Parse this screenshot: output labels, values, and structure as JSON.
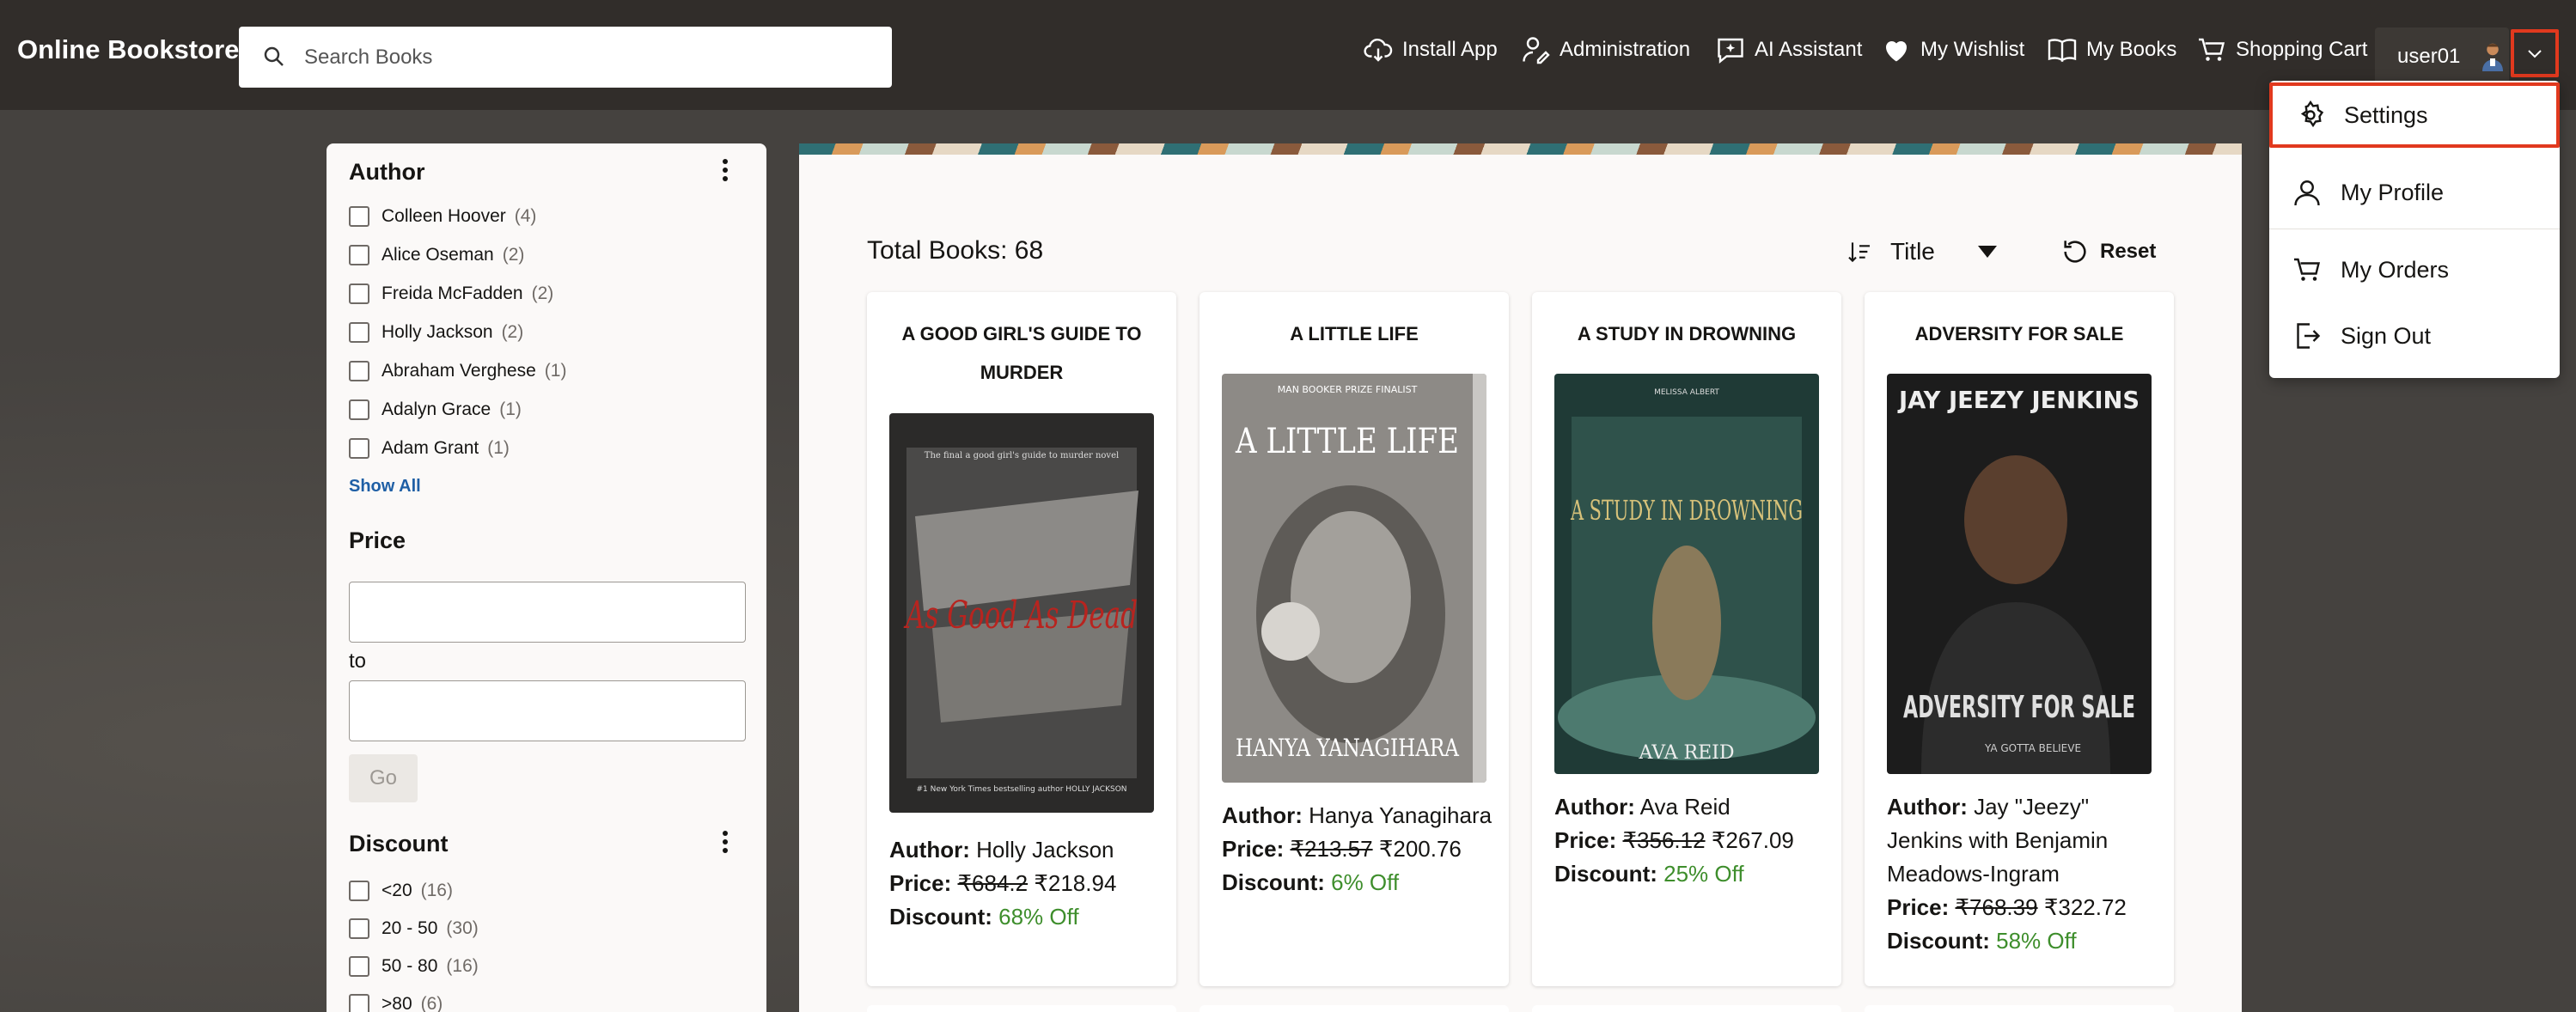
{
  "header": {
    "brand": "Online Bookstore",
    "search_placeholder": "Search Books",
    "nav": {
      "install_app": "Install App",
      "administration": "Administration",
      "ai_assistant": "AI Assistant",
      "wishlist": "My Wishlist",
      "my_books": "My Books",
      "cart": "Shopping Cart"
    },
    "username": "user01"
  },
  "user_menu": {
    "items": [
      {
        "label": "Settings",
        "icon": "gear-icon"
      },
      {
        "label": "My Profile",
        "icon": "person-icon"
      },
      {
        "label": "My Orders",
        "icon": "cart-icon"
      },
      {
        "label": "Sign Out",
        "icon": "sign-out-icon"
      }
    ]
  },
  "filters": {
    "author": {
      "title": "Author",
      "items": [
        {
          "name": "Colleen Hoover",
          "count": "(4)"
        },
        {
          "name": "Alice Oseman",
          "count": "(2)"
        },
        {
          "name": "Freida McFadden",
          "count": "(2)"
        },
        {
          "name": "Holly Jackson",
          "count": "(2)"
        },
        {
          "name": "Abraham Verghese",
          "count": "(1)"
        },
        {
          "name": "Adalyn Grace",
          "count": "(1)"
        },
        {
          "name": "Adam Grant",
          "count": "(1)"
        }
      ],
      "show_all": "Show All"
    },
    "price": {
      "title": "Price",
      "to_label": "to",
      "go_label": "Go",
      "from_value": "",
      "to_value": ""
    },
    "discount": {
      "title": "Discount",
      "items": [
        {
          "name": "<20",
          "count": "(16)"
        },
        {
          "name": "20 - 50",
          "count": "(30)"
        },
        {
          "name": "50 - 80",
          "count": "(16)"
        },
        {
          "name": ">80",
          "count": "(6)"
        }
      ]
    }
  },
  "results": {
    "total_label": "Total Books: 68",
    "sort_value": "Title",
    "reset_label": "Reset"
  },
  "labels": {
    "author": "Author:",
    "price": "Price:",
    "discount": "Discount:"
  },
  "books": [
    {
      "title": "A Good Girl's Guide to Murder",
      "author": "Holly Jackson",
      "old_price": "₹684.2",
      "price": "₹218.94",
      "discount": "68% Off",
      "cover": {
        "top": "The final a good girl's guide to murder novel",
        "main": "As Good As Dead",
        "bottom": "#1 New York Times bestselling author HOLLY JACKSON"
      }
    },
    {
      "title": "A Little Life",
      "author": "Hanya Yanagihara",
      "old_price": "₹213.57",
      "price": "₹200.76",
      "discount": "6% Off",
      "cover": {
        "top": "MAN BOOKER PRIZE FINALIST",
        "main": "A LITTLE LIFE",
        "bottom": "HANYA YANAGIHARA"
      }
    },
    {
      "title": "A Study in Drowning",
      "author": "Ava Reid",
      "old_price": "₹356.12",
      "price": "₹267.09",
      "discount": "25% Off",
      "cover": {
        "top": "MELISSA ALBERT",
        "main": "A STUDY IN DROWNING",
        "bottom": "AVA REID"
      }
    },
    {
      "title": "Adversity for Sale",
      "author": "Jay \"Jeezy\" Jenkins with Benjamin Meadows-Ingram",
      "old_price": "₹768.39",
      "price": "₹322.72",
      "discount": "58% Off",
      "cover": {
        "top": "JAY JEEZY JENKINS",
        "main": "ADVERSITY FOR SALE",
        "bottom": "YA GOTTA BELIEVE"
      }
    }
  ]
}
